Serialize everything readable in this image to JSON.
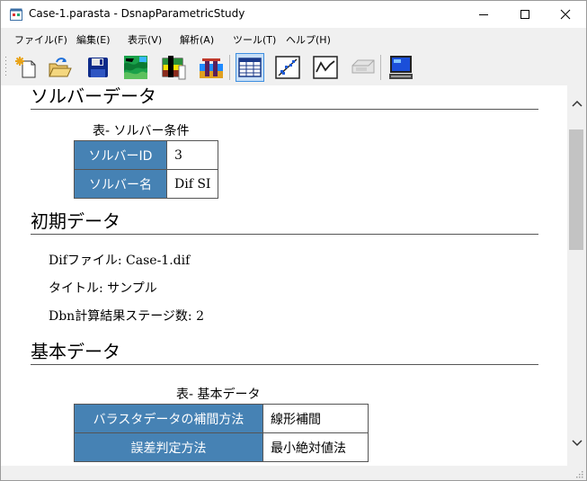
{
  "window": {
    "title": "Case-1.parasta - DsnapParametricStudy"
  },
  "menu": [
    {
      "label": "ファイル(F)"
    },
    {
      "label": "編集(E)"
    },
    {
      "label": "表示(V)"
    },
    {
      "label": "解析(A)"
    },
    {
      "label": "ツール(T)"
    },
    {
      "label": "ヘルプ(H)"
    }
  ],
  "toolbar": {
    "buttons": [
      {
        "icon": "new-file-icon"
      },
      {
        "icon": "open-folder-icon"
      },
      {
        "icon": "save-icon"
      },
      {
        "icon": "terrain-map-icon"
      },
      {
        "icon": "soil-layer-icon"
      },
      {
        "icon": "structure-icon"
      },
      {
        "icon": "table-view-icon",
        "active": true
      },
      {
        "icon": "scatter-chart-icon"
      },
      {
        "icon": "line-chart-icon"
      },
      {
        "icon": "disabled-tool-icon",
        "disabled": true
      },
      {
        "icon": "monitor-icon"
      }
    ]
  },
  "report": {
    "solver": {
      "heading": "ソルバーデータ",
      "table_caption": "表- ソルバー条件",
      "rows": [
        {
          "label": "ソルバーID",
          "value": "3"
        },
        {
          "label": "ソルバー名",
          "value": "Dif SI"
        }
      ]
    },
    "initial": {
      "heading": "初期データ",
      "lines": [
        "Difファイル: Case-1.dif",
        "タイトル: サンプル",
        "Dbn計算結果ステージ数: 2"
      ]
    },
    "basic": {
      "heading": "基本データ",
      "table_caption": "表- 基本データ",
      "rows": [
        {
          "label": "バラスタデータの補間方法",
          "value": "線形補間"
        },
        {
          "label": "誤差判定方法",
          "value": "最小絶対値法"
        }
      ]
    }
  },
  "colors": {
    "table_header_bg": "#4682b4",
    "table_header_text": "#ffffff",
    "active_button_bg": "#c9e0f7",
    "active_button_border": "#3d8ee0"
  }
}
